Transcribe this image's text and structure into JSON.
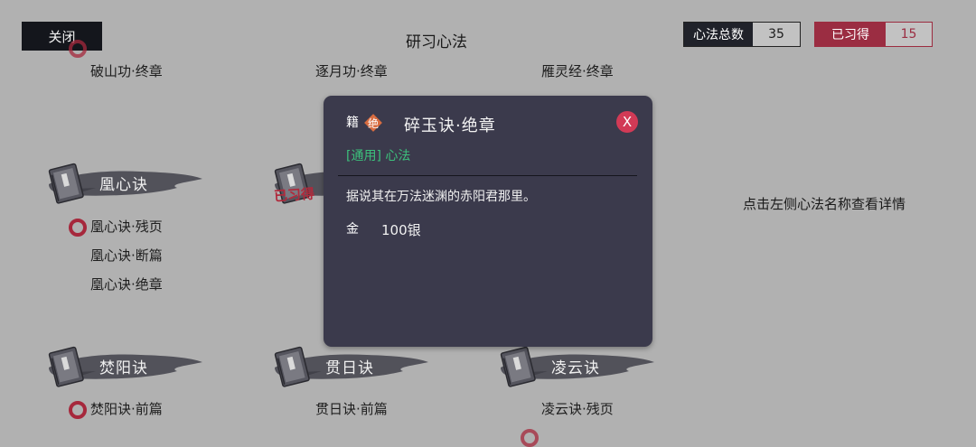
{
  "header": {
    "close_label": "关闭",
    "title": "研习心法",
    "total_label": "心法总数",
    "total_value": "35",
    "owned_label": "已习得",
    "owned_value": "15"
  },
  "top_row": [
    "破山功·终章",
    "逐月功·终章",
    "雁灵经·终章"
  ],
  "groups": {
    "huang": {
      "name": "凰心诀",
      "items": [
        "凰心诀·残页",
        "凰心诀·断篇",
        "凰心诀·绝章"
      ]
    },
    "mid": {
      "owned_stamp": "已习得"
    },
    "fen": {
      "name": "焚阳诀",
      "items": [
        "焚阳诀·前篇"
      ]
    },
    "guan": {
      "name": "贯日诀",
      "items": [
        "贯日诀·前篇"
      ]
    },
    "ling": {
      "name": "凌云诀",
      "items": [
        "凌云诀·残页"
      ]
    }
  },
  "hint": "点击左侧心法名称查看详情",
  "popup": {
    "badge_ji": "籍",
    "badge_jue": "绝",
    "title": "碎玉诀·绝章",
    "close_label": "X",
    "tag": "[通用] 心法",
    "description": "据说其在万法迷渊的赤阳君那里。",
    "coin_icon_label": "金",
    "price": "100银"
  },
  "colors": {
    "background": "#b1b1b1",
    "popup": "#3b3a4c",
    "accent_red": "#9b2d42",
    "tag_green": "#3cc07c",
    "close_red": "#d23a56",
    "jue_orange": "#d86c40"
  }
}
